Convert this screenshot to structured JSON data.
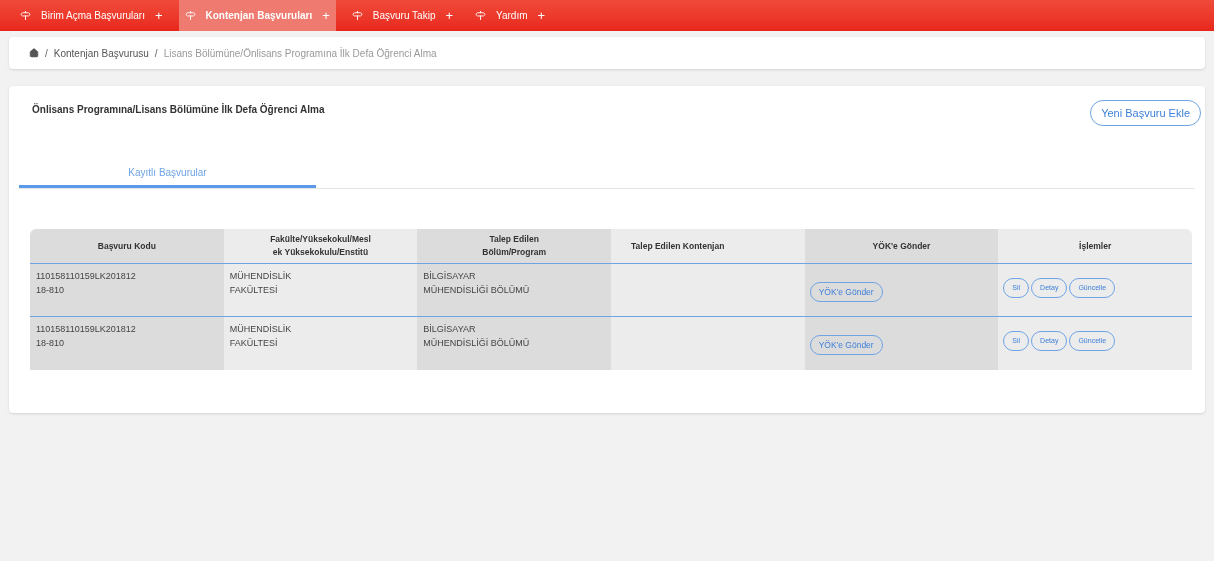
{
  "menu": [
    {
      "label": "Birim Açma Başvuruları",
      "plus": "+",
      "selected": false
    },
    {
      "label": "Kontenjan Başvuruları",
      "plus": "+",
      "selected": true
    },
    {
      "label": "Başvuru Takip",
      "plus": "+",
      "selected": false
    },
    {
      "label": "Yardım",
      "plus": "+",
      "selected": false
    }
  ],
  "breadcrumb": [
    {
      "label": "Kontenjan Başvurusu",
      "separator": "/"
    },
    {
      "label": "Lisans Bölümüne/Önlisans Programına İlk Defa Öğrenci Alma",
      "separator": "/"
    }
  ],
  "card": {
    "title": "Önlisans Programına/Lisans Bölümüne İlk Defa Öğrenci Alma",
    "add_button": "Yeni Başvuru Ekle"
  },
  "tabs": [
    {
      "label": "Kayıtlı Başvurular",
      "selected": true
    }
  ],
  "table": {
    "columns": [
      [
        "Başvuru Kodu"
      ],
      [
        "Fakülte/Yüksekokul/Mesl",
        "ek Yüksekokulu/Enstitü"
      ],
      [
        "Talep Edilen",
        "Bölüm/Program"
      ],
      [
        "Talep Edilen Kontenjan"
      ],
      [
        "YÖK'e Gönder"
      ],
      [
        "İşlemler"
      ]
    ],
    "rows": [
      {
        "code": [
          "110158110159LK201812",
          "18-810"
        ],
        "faculty": [
          "MÜHENDİSLİK",
          "FAKÜLTESİ"
        ],
        "program": [
          "BİLGİSAYAR",
          "MÜHENDİSLİĞİ BÖLÜMÜ"
        ],
        "send": "YÖK'e Gönder",
        "actions": [
          "Sil",
          "Detay",
          "Güncelle"
        ]
      },
      {
        "code": [
          "110158110159LK201812",
          "18-810"
        ],
        "faculty": [
          "MÜHENDİSLİK",
          "FAKÜLTESİ"
        ],
        "program": [
          "BİLGİSAYAR",
          "MÜHENDİSLİĞİ BÖLÜMÜ"
        ],
        "send": "YÖK'e Gönder",
        "actions": [
          "Sil",
          "Detay",
          "Güncelle"
        ]
      }
    ]
  }
}
